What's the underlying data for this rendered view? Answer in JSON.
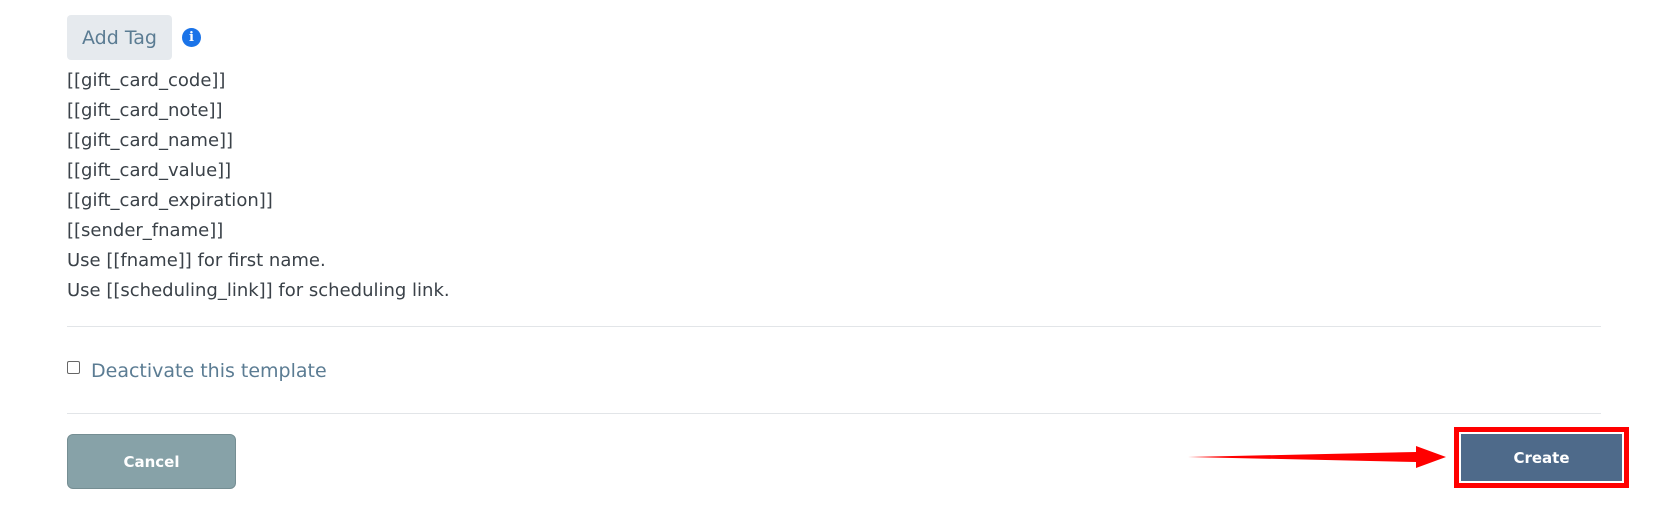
{
  "tags": {
    "add_tag_label": "Add Tag",
    "info_icon": "i",
    "items": [
      "[[gift_card_code]]",
      "[[gift_card_note]]",
      "[[gift_card_name]]",
      "[[gift_card_value]]",
      "[[gift_card_expiration]]",
      "[[sender_fname]]",
      "Use [[fname]] for first name.",
      "Use [[scheduling_link]] for scheduling link."
    ]
  },
  "deactivate": {
    "label": "Deactivate this template",
    "checked": false
  },
  "actions": {
    "cancel_label": "Cancel",
    "create_label": "Create"
  },
  "colors": {
    "info_blue": "#1a73e8",
    "cancel_bg": "#87a2a8",
    "create_bg": "#4e6a8a",
    "highlight_red": "#ff0000"
  },
  "icons": {
    "info": "info-circle-icon",
    "annotation_arrow": "red-arrow-icon"
  }
}
